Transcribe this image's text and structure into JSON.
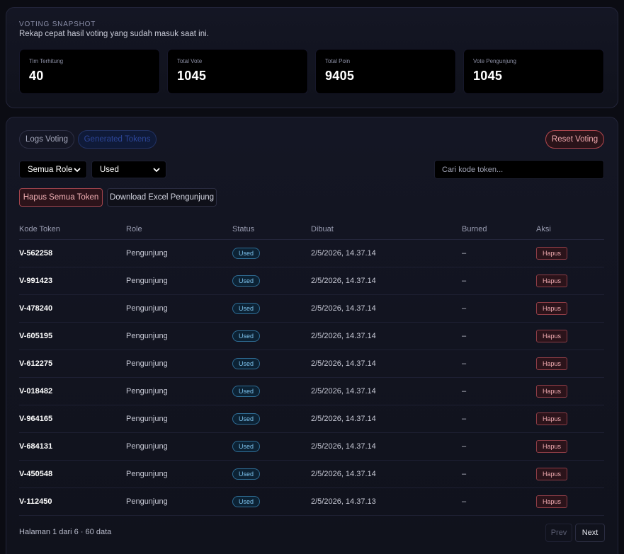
{
  "snapshot": {
    "title": "VOTING SNAPSHOT",
    "subtitle": "Rekap cepat hasil voting yang sudah masuk saat ini.",
    "stats": [
      {
        "label": "Tim Terhitung",
        "value": "40"
      },
      {
        "label": "Total Vote",
        "value": "1045"
      },
      {
        "label": "Total Poin",
        "value": "9405"
      },
      {
        "label": "Vote Pengunjung",
        "value": "1045"
      }
    ]
  },
  "tabs": {
    "logs": "Logs Voting",
    "generated": "Generated Tokens",
    "active": "generated"
  },
  "reset_label": "Reset Voting",
  "filters": {
    "role": "Semua Role",
    "status": "Used",
    "search_placeholder": "Cari kode token..."
  },
  "actions": {
    "delete_all": "Hapus Semua Token",
    "download": "Download Excel Pengunjung"
  },
  "table": {
    "headers": [
      "Kode Token",
      "Role",
      "Status",
      "Dibuat",
      "Burned",
      "Aksi"
    ],
    "rows": [
      {
        "code": "V-562258",
        "role": "Pengunjung",
        "status": "Used",
        "created": "2/5/2026, 14.37.14",
        "burned": "–",
        "action": "Hapus"
      },
      {
        "code": "V-991423",
        "role": "Pengunjung",
        "status": "Used",
        "created": "2/5/2026, 14.37.14",
        "burned": "–",
        "action": "Hapus"
      },
      {
        "code": "V-478240",
        "role": "Pengunjung",
        "status": "Used",
        "created": "2/5/2026, 14.37.14",
        "burned": "–",
        "action": "Hapus"
      },
      {
        "code": "V-605195",
        "role": "Pengunjung",
        "status": "Used",
        "created": "2/5/2026, 14.37.14",
        "burned": "–",
        "action": "Hapus"
      },
      {
        "code": "V-612275",
        "role": "Pengunjung",
        "status": "Used",
        "created": "2/5/2026, 14.37.14",
        "burned": "–",
        "action": "Hapus"
      },
      {
        "code": "V-018482",
        "role": "Pengunjung",
        "status": "Used",
        "created": "2/5/2026, 14.37.14",
        "burned": "–",
        "action": "Hapus"
      },
      {
        "code": "V-964165",
        "role": "Pengunjung",
        "status": "Used",
        "created": "2/5/2026, 14.37.14",
        "burned": "–",
        "action": "Hapus"
      },
      {
        "code": "V-684131",
        "role": "Pengunjung",
        "status": "Used",
        "created": "2/5/2026, 14.37.14",
        "burned": "–",
        "action": "Hapus"
      },
      {
        "code": "V-450548",
        "role": "Pengunjung",
        "status": "Used",
        "created": "2/5/2026, 14.37.14",
        "burned": "–",
        "action": "Hapus"
      },
      {
        "code": "V-112450",
        "role": "Pengunjung",
        "status": "Used",
        "created": "2/5/2026, 14.37.13",
        "burned": "–",
        "action": "Hapus"
      }
    ]
  },
  "pagination": {
    "info": "Halaman 1 dari 6 · 60 data",
    "prev": "Prev",
    "next": "Next"
  },
  "icons": {
    "select_chevron": "chevron-down-icon"
  },
  "colors": {
    "background": "#0b0c13",
    "used_badge": "#7dc3ee",
    "danger": "#b2474e",
    "active_tab": "#2d4699"
  }
}
